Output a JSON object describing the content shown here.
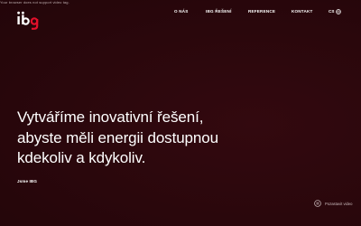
{
  "video_fallback_text": "Your browser does not support video tag.",
  "logo": {
    "text": "ibg",
    "brand_color": "#e3102b"
  },
  "nav": {
    "items": [
      {
        "label": "O NÁS"
      },
      {
        "label": "IBG ŘEŠENÍ"
      },
      {
        "label": "REFERENCE"
      },
      {
        "label": "KONTAKT"
      }
    ],
    "lang_label": "CS",
    "lang_icon": "globe-icon"
  },
  "hero": {
    "headline_lines": [
      "Vytváříme inovativní řešení,",
      "abyste měli energii dostupnou",
      "kdekoliv a kdykoliv."
    ],
    "brand_line": "Jsme IBG"
  },
  "video_toggle": {
    "label": "Pozastavit video",
    "icon": "pause-circle-icon"
  },
  "colors": {
    "background": "#2a070c",
    "text": "#ffffff",
    "accent": "#e3102b"
  }
}
